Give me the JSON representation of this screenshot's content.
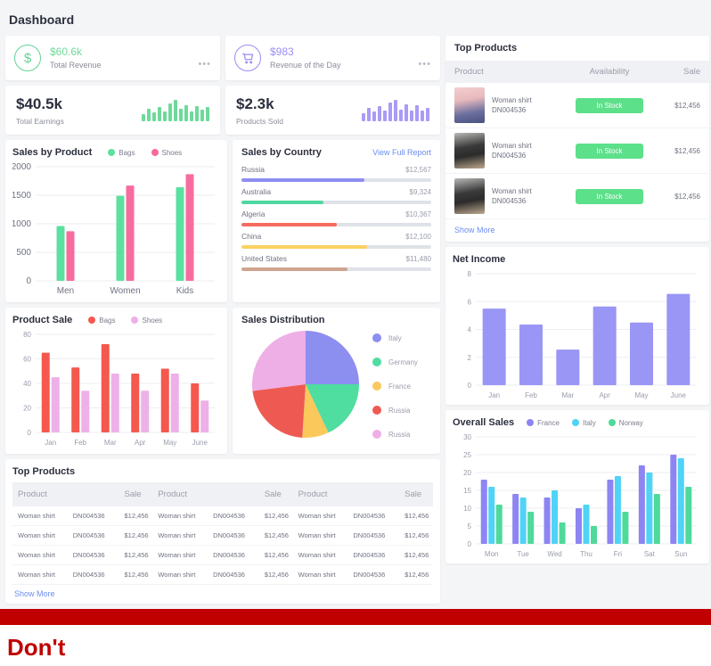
{
  "page": {
    "title": "Dashboard",
    "footer_label": "Don't",
    "accent_red": "#c00000"
  },
  "kpi": {
    "cards": [
      {
        "icon": "dollar-icon",
        "amount": "$60.6k",
        "label": "Total Revenue",
        "color": "#6ed99b",
        "menu": "•••"
      },
      {
        "icon": "cart-icon",
        "amount": "$983",
        "label": "Revenue of the Day",
        "color": "#9a8cf5",
        "menu": "•••"
      }
    ],
    "stats": [
      {
        "value": "$40.5k",
        "label": "Total Earnings",
        "color": "#6ed99b",
        "spark": [
          8,
          14,
          10,
          16,
          11,
          20,
          24,
          14,
          18,
          11,
          17,
          13,
          16
        ]
      },
      {
        "value": "$2.3k",
        "label": "Products Sold",
        "color": "#a99bf7",
        "spark": [
          9,
          15,
          11,
          17,
          12,
          21,
          24,
          13,
          19,
          12,
          18,
          12,
          15
        ]
      }
    ]
  },
  "top_products_panel": {
    "title": "Top Products",
    "columns": [
      "Product",
      "Availability",
      "Sale"
    ],
    "rows": [
      {
        "name": "Woman shirt",
        "sku": "DN004536",
        "status": "In Stock",
        "sale": "$12,456",
        "thumb": "pink"
      },
      {
        "name": "Woman shirt",
        "sku": "DN004536",
        "status": "In Stock",
        "sale": "$12,456",
        "thumb": "gray"
      },
      {
        "name": "Woman shirt",
        "sku": "DN004536",
        "status": "In Stock",
        "sale": "$12,456",
        "thumb": "gray"
      }
    ],
    "show_more": "Show More"
  },
  "sales_by_country": {
    "title": "Sales by Country",
    "link": "View Full Report",
    "rows": [
      {
        "name": "Russia",
        "value": "$12,567",
        "pct": 65,
        "color": "#8c8ef0"
      },
      {
        "name": "Australia",
        "value": "$9,324",
        "pct": 43,
        "color": "#4ed8a0"
      },
      {
        "name": "Algeria",
        "value": "$10,367",
        "pct": 50,
        "color": "#f56c5f"
      },
      {
        "name": "China",
        "value": "$12,100",
        "pct": 66,
        "color": "#fbd162"
      },
      {
        "name": "United States",
        "value": "$11,480",
        "pct": 56,
        "color": "#cfa48f"
      }
    ]
  },
  "chart_data": [
    {
      "id": "sales_by_product",
      "type": "bar",
      "title": "Sales by Product",
      "categories": [
        "Men",
        "Women",
        "Kids"
      ],
      "series": [
        {
          "name": "Bags",
          "color": "#5ce0a0",
          "values": [
            960,
            1490,
            1640
          ]
        },
        {
          "name": "Shoes",
          "color": "#f86b9e",
          "values": [
            870,
            1670,
            1870
          ]
        }
      ],
      "xlabel": "",
      "ylabel": "",
      "ylim": [
        0,
        2000
      ],
      "yticks": [
        0,
        500,
        1000,
        1500,
        2000
      ],
      "grid": true,
      "legend": "top-right"
    },
    {
      "id": "product_sale",
      "type": "bar",
      "title": "Product Sale",
      "categories": [
        "Jan",
        "Feb",
        "Mar",
        "Apr",
        "May",
        "June"
      ],
      "series": [
        {
          "name": "Bags",
          "color": "#f5584e",
          "values": [
            65,
            53,
            72,
            48,
            52,
            40
          ]
        },
        {
          "name": "Shoes",
          "color": "#eeb0e8",
          "values": [
            45,
            34,
            48,
            34,
            48,
            26
          ]
        }
      ],
      "xlabel": "",
      "ylabel": "",
      "ylim": [
        0,
        80
      ],
      "yticks": [
        0,
        20,
        40,
        60,
        80
      ],
      "grid": true,
      "legend": "top-right"
    },
    {
      "id": "sales_distribution",
      "type": "pie",
      "title": "Sales Distribution",
      "slices": [
        {
          "label": "Italy",
          "value": 25,
          "color": "#8c8ef0"
        },
        {
          "label": "Germany",
          "value": 18,
          "color": "#4fddA0"
        },
        {
          "label": "France",
          "value": 8,
          "color": "#fbc85c"
        },
        {
          "label": "Russia",
          "value": 22,
          "color": "#ee5a52"
        },
        {
          "label": "Russia",
          "value": 27,
          "color": "#eeaee6"
        }
      ],
      "legend": "right"
    },
    {
      "id": "net_income",
      "type": "bar",
      "title": "Net Income",
      "categories": [
        "Jan",
        "Feb",
        "Mar",
        "Apr",
        "May",
        "June"
      ],
      "series": [
        {
          "name": "Net Income",
          "color": "#9a96f5",
          "values": [
            5.5,
            4.35,
            2.55,
            5.65,
            4.5,
            6.55
          ]
        }
      ],
      "xlabel": "",
      "ylabel": "",
      "ylim": [
        0,
        8
      ],
      "yticks": [
        0,
        2,
        4,
        6,
        8
      ],
      "grid": true,
      "legend": "none"
    },
    {
      "id": "overall_sales",
      "type": "bar",
      "title": "Overall Sales",
      "categories": [
        "Mon",
        "Tue",
        "Wed",
        "Thu",
        "Fri",
        "Sat",
        "Sun"
      ],
      "series": [
        {
          "name": "France",
          "color": "#8c85f2",
          "values": [
            18,
            14,
            13,
            10,
            18,
            22,
            25
          ]
        },
        {
          "name": "Italy",
          "color": "#4fd3f7",
          "values": [
            16,
            13,
            15,
            11,
            19,
            20,
            24
          ]
        },
        {
          "name": "Norway",
          "color": "#4fd99a",
          "values": [
            11,
            9,
            6,
            5,
            9,
            14,
            16
          ]
        }
      ],
      "xlabel": "",
      "ylabel": "",
      "ylim": [
        0,
        30
      ],
      "yticks": [
        0,
        5,
        10,
        15,
        20,
        25,
        30
      ],
      "grid": true,
      "legend": "top-right"
    }
  ],
  "bottom_table": {
    "title": "Top Products",
    "columns": [
      "Product",
      "Sale",
      "Product",
      "Sale",
      "Product",
      "Sale"
    ],
    "rows": [
      [
        "Woman shirt",
        "DN004536",
        "$12,456",
        "Woman shirt",
        "DN004536",
        "$12,456",
        "Woman shirt",
        "DN004536",
        "$12,456"
      ],
      [
        "Woman shirt",
        "DN004536",
        "$12,456",
        "Woman shirt",
        "DN004536",
        "$12,456",
        "Woman shirt",
        "DN004536",
        "$12,456"
      ],
      [
        "Woman shirt",
        "DN004536",
        "$12,456",
        "Woman shirt",
        "DN004536",
        "$12,456",
        "Woman shirt",
        "DN004536",
        "$12,456"
      ],
      [
        "Woman shirt",
        "DN004536",
        "$12,456",
        "Woman shirt",
        "DN004536",
        "$12,456",
        "Woman shirt",
        "DN004536",
        "$12,456"
      ]
    ],
    "show_more": "Show More"
  }
}
